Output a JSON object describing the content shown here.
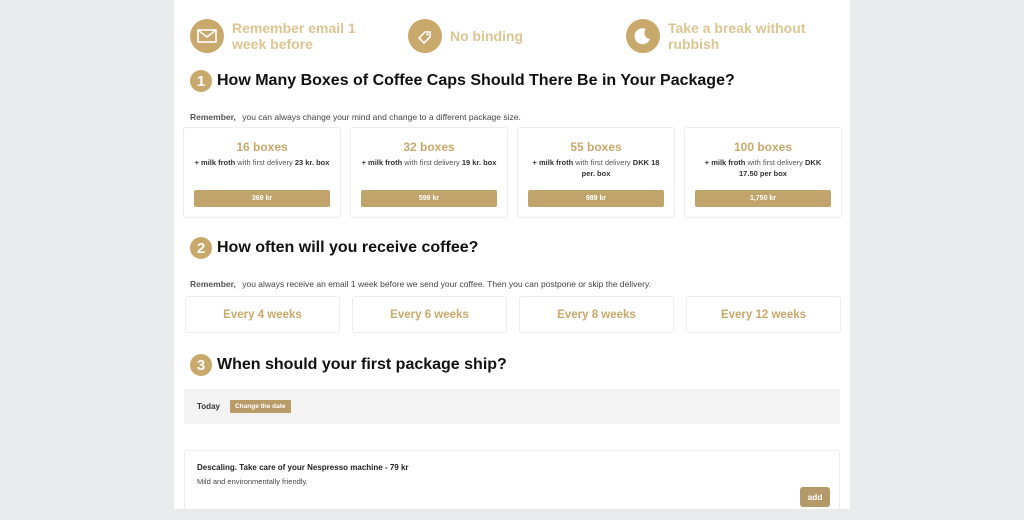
{
  "perks": [
    {
      "icon": "envelope-icon",
      "text": "Remember email 1 week before"
    },
    {
      "icon": "tag-icon",
      "text": "No binding"
    },
    {
      "icon": "moon-icon",
      "text": "Take a break without rubbish"
    }
  ],
  "step1": {
    "number": "1",
    "title": "How Many Boxes of Coffee Caps Should There Be in Your Package?",
    "note_bold": "Remember,",
    "note": "you can always change your mind and change to a different package size.",
    "packages": [
      {
        "title": "16 boxes",
        "desc_a": "+ milk froth",
        "desc_b": " with first delivery ",
        "desc_c": "23 kr. box",
        "price": "369  kr"
      },
      {
        "title": "32 boxes",
        "desc_a": "+ milk froth",
        "desc_b": " with first delivery ",
        "desc_c": "19 kr. box",
        "price": "599  kr"
      },
      {
        "title": "55 boxes",
        "desc_a": "+ milk froth",
        "desc_b": " with first delivery ",
        "desc_c": "DKK 18 per. box",
        "price": "989  kr"
      },
      {
        "title": "100 boxes",
        "desc_a": "+ milk froth",
        "desc_b": " with first delivery ",
        "desc_c": "DKK 17.50 per box",
        "price": "1,750  kr"
      }
    ]
  },
  "step2": {
    "number": "2",
    "title": "How often will you receive coffee?",
    "note_bold": "Remember,",
    "note": "you always receive an email 1 week before we send your coffee. Then you can postpone or skip the delivery.",
    "options": [
      "Every 4 weeks",
      "Every 6 weeks",
      "Every 8 weeks",
      "Every 12 weeks"
    ]
  },
  "step3": {
    "number": "3",
    "title": "When should your first package ship?",
    "date_label": "Today",
    "change_label": "Change the date"
  },
  "addon": {
    "title": "Descaling. Take care of your Nespresso machine - 79  kr",
    "desc": "Mild and environmentally friendly.",
    "add_label": "add"
  },
  "colors": {
    "accent": "#c9a86b",
    "background": "#e8eaeb"
  }
}
